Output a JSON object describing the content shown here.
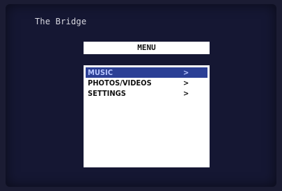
{
  "app": {
    "title": "The Bridge"
  },
  "menu": {
    "header": "MENU",
    "items": [
      {
        "label": "MUSIC",
        "arrow": ">",
        "selected": true
      },
      {
        "label": "PHOTOS/VIDEOS",
        "arrow": ">",
        "selected": false
      },
      {
        "label": "SETTINGS",
        "arrow": ">",
        "selected": false
      }
    ]
  },
  "colors": {
    "background": "#1b1c33",
    "selection": "#2b3f95",
    "selection_text": "#b8c6ff",
    "panel": "#ffffff"
  }
}
